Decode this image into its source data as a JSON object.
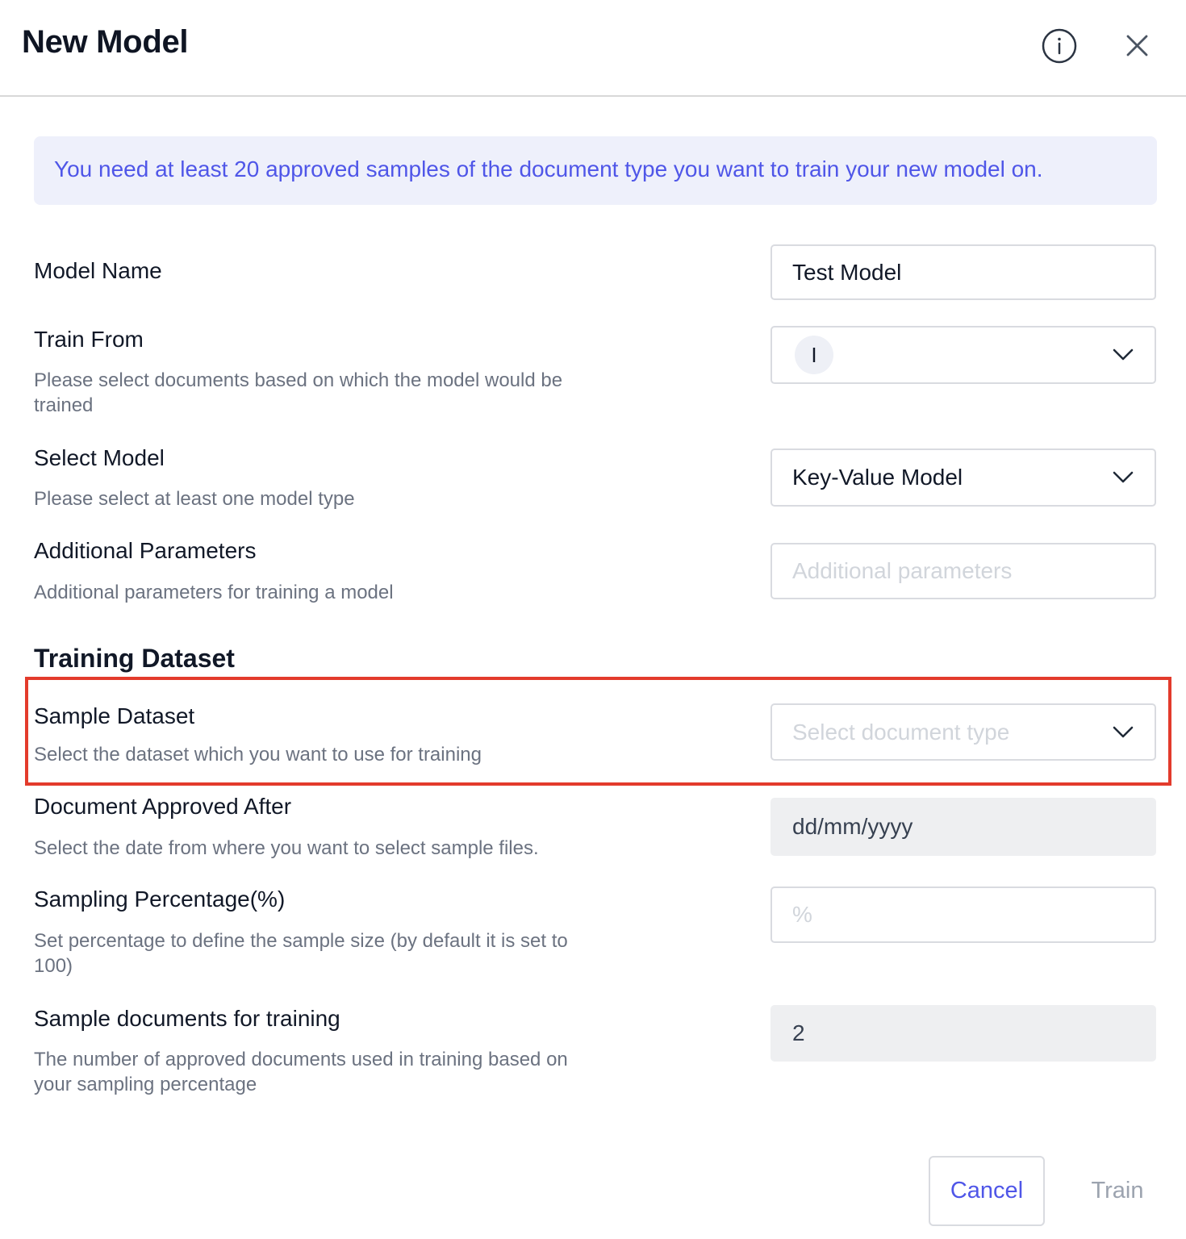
{
  "dialog": {
    "title": "New Model",
    "info_icon": "info-circle-icon",
    "close_icon": "close-x-icon"
  },
  "banner": {
    "text": "You need at least 20 approved samples of the document type you want to train your new model on."
  },
  "form": {
    "model_name": {
      "label": "Model Name",
      "value": "Test Model"
    },
    "train_from": {
      "label": "Train From",
      "help": "Please select documents based on which the model would be trained",
      "avatar_letter": "I"
    },
    "select_model": {
      "label": "Select Model",
      "help": "Please select at least one model type",
      "value": "Key-Value Model"
    },
    "additional_parameters": {
      "label": "Additional Parameters",
      "help": "Additional parameters for training a model",
      "placeholder": "Additional parameters"
    },
    "training_dataset": {
      "section_title": "Training Dataset"
    },
    "sample_dataset": {
      "label": "Sample Dataset",
      "help": "Select the dataset which you want to use for training",
      "placeholder": "Select document type"
    },
    "document_approved_after": {
      "label": "Document Approved After",
      "help": "Select the date from where you want to select sample files.",
      "value": "dd/mm/yyyy"
    },
    "sampling_percentage": {
      "label": "Sampling Percentage(%)",
      "help": "Set percentage to define the sample size (by default it is set to 100)",
      "placeholder": "%"
    },
    "sample_documents": {
      "label": "Sample documents for training",
      "help": "The number of approved documents used in training based on your sampling percentage",
      "value": "2"
    }
  },
  "footer": {
    "cancel_label": "Cancel",
    "train_label": "Train"
  },
  "colors": {
    "accent": "#4f56e8",
    "banner_bg": "#eef0fb",
    "highlight_border": "#e33b2c",
    "disabled_bg": "#eeeff1"
  }
}
